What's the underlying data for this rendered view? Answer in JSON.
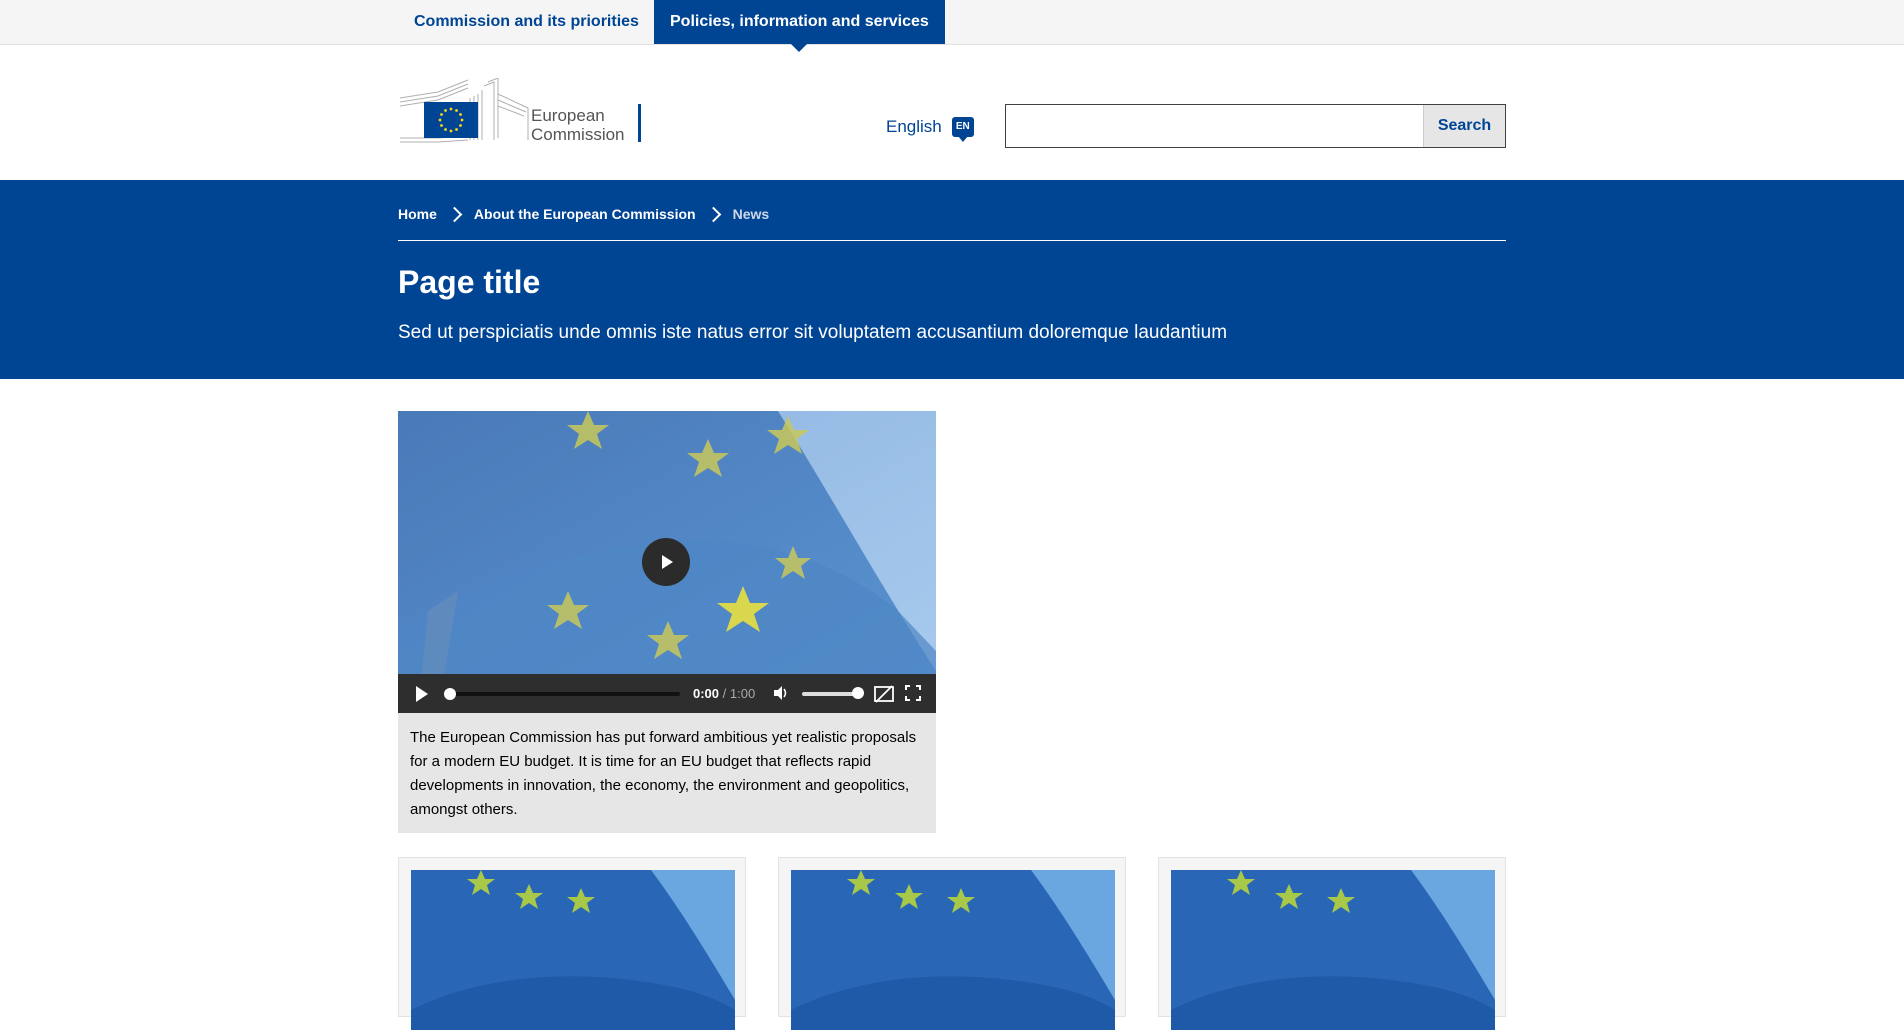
{
  "topnav": {
    "tabs": [
      {
        "label": "Commission and its priorities"
      },
      {
        "label": "Policies, information and services"
      }
    ]
  },
  "header": {
    "logo_line1": "European",
    "logo_line2": "Commission",
    "language_label": "English",
    "language_code": "EN",
    "search": {
      "placeholder": "",
      "value": "",
      "button_label": "Search"
    }
  },
  "breadcrumb": {
    "items": [
      "Home",
      "About the European Commission",
      "News"
    ]
  },
  "page": {
    "title": "Page title",
    "subtitle": "Sed ut perspiciatis unde omnis iste natus error sit voluptatem accusantium doloremque laudantium"
  },
  "video": {
    "current_time": "0:00",
    "separator": "/",
    "duration": "1:00",
    "progress": 0,
    "volume": 1,
    "caption": "The European Commission has put forward ambitious yet realistic proposals for a modern EU budget. It is time for an EU budget that reflects rapid developments in innovation, the economy, the environment and geopolitics, amongst others."
  },
  "colors": {
    "brand_blue": "#004494",
    "star_yellow": "#ffd617",
    "light_grey": "#f5f5f5"
  }
}
